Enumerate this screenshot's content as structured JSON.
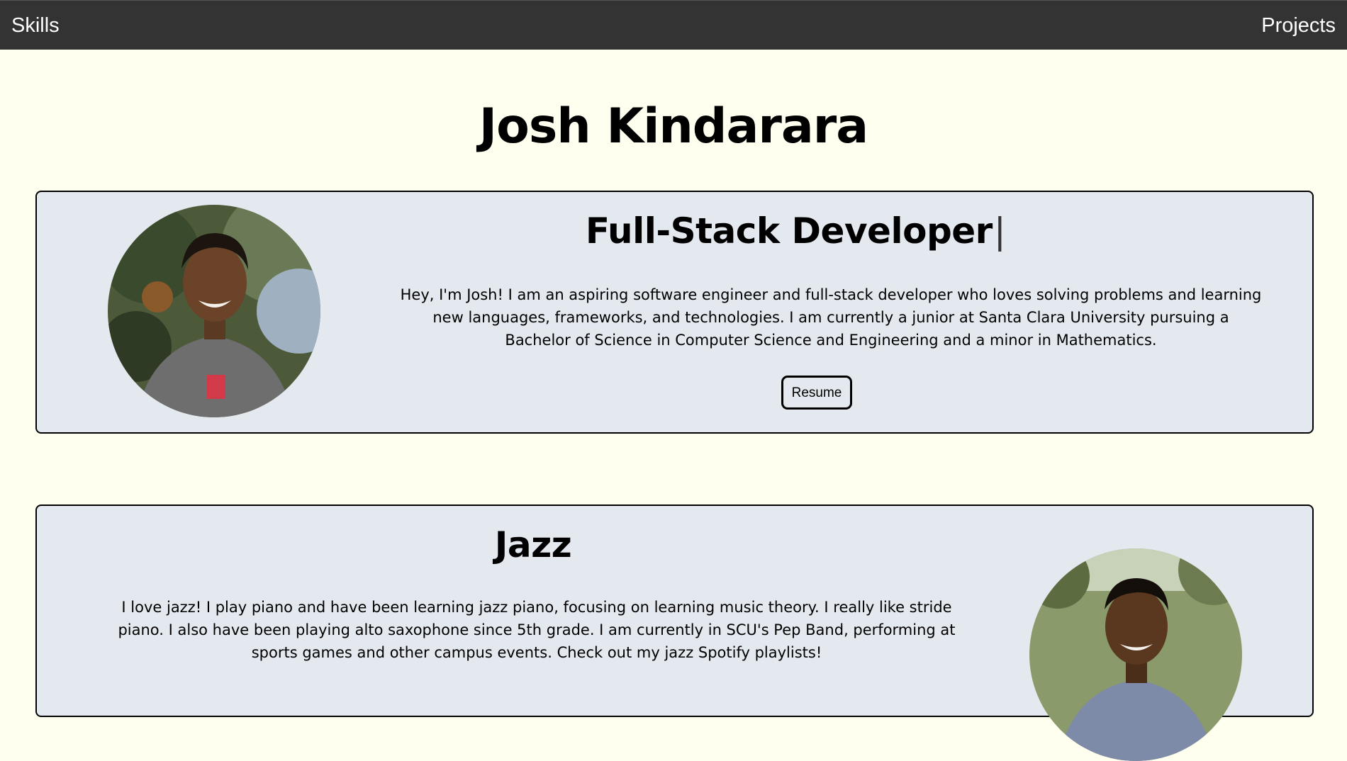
{
  "nav": {
    "skills_label": "Skills",
    "projects_label": "Projects"
  },
  "page_title": "Josh Kindarara",
  "developer_card": {
    "heading": "Full-Stack Developer",
    "cursor": "|",
    "description": "Hey, I'm Josh! I am an aspiring software engineer and full-stack developer who loves solving problems and learning new languages, frameworks, and technologies. I am currently a junior at Santa Clara University pursuing a Bachelor of Science in Computer Science and Engineering and a minor in Mathematics.",
    "resume_label": "Resume"
  },
  "jazz_card": {
    "heading": "Jazz",
    "description": "I love jazz! I play piano and have been learning jazz piano, focusing on learning music theory. I really like stride piano. I also have been playing alto saxophone since 5th grade. I am currently in SCU's Pep Band, performing at sports games and other campus events. Check out my jazz Spotify playlists!"
  },
  "colors": {
    "nav_background": "#333333",
    "page_background": "#fffff0",
    "card_background": "#e4e8ef",
    "text": "#000000"
  }
}
